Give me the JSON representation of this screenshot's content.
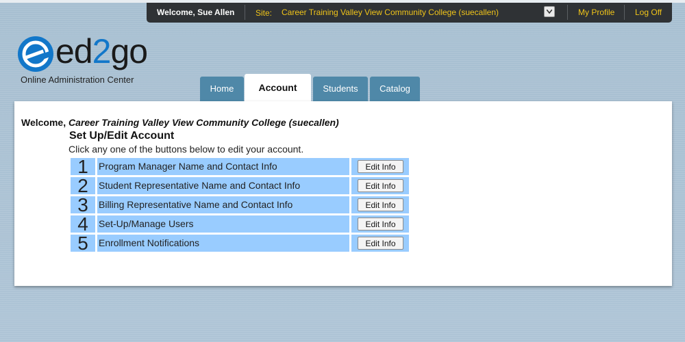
{
  "topbar": {
    "welcome": "Welcome, Sue Allen",
    "site_label": "Site:",
    "site_value": "Career Training Valley View Community College (suecallen)",
    "my_profile": "My Profile",
    "log_off": "Log Off"
  },
  "logo": {
    "text_before": "ed",
    "text_two": "2",
    "text_after": "go",
    "subtitle": "Online Administration Center"
  },
  "tabs": [
    {
      "label": "Home",
      "active": false
    },
    {
      "label": "Account",
      "active": true
    },
    {
      "label": "Students",
      "active": false
    },
    {
      "label": "Catalog",
      "active": false
    }
  ],
  "main": {
    "welcome_prefix": "Welcome,",
    "welcome_college": "Career Training Valley View Community College (suecallen)",
    "title": "Set Up/Edit Account",
    "description": "Click any one of the buttons below to edit your account.",
    "items": [
      {
        "number": "1",
        "label": "Program Manager Name and Contact Info",
        "button": "Edit Info"
      },
      {
        "number": "2",
        "label": "Student Representative Name and Contact Info",
        "button": "Edit Info"
      },
      {
        "number": "3",
        "label": "Billing Representative Name and Contact Info",
        "button": "Edit Info"
      },
      {
        "number": "4",
        "label": "Set-Up/Manage Users",
        "button": "Edit Info"
      },
      {
        "number": "5",
        "label": "Enrollment Notifications",
        "button": "Edit Info"
      }
    ]
  },
  "colors": {
    "background": "#a9c0d2",
    "topbar": "#2f3235",
    "topbar_link": "#f0c419",
    "tab": "#4f88a8",
    "row_fill": "#99ccff",
    "brand_blue": "#1277c9"
  }
}
